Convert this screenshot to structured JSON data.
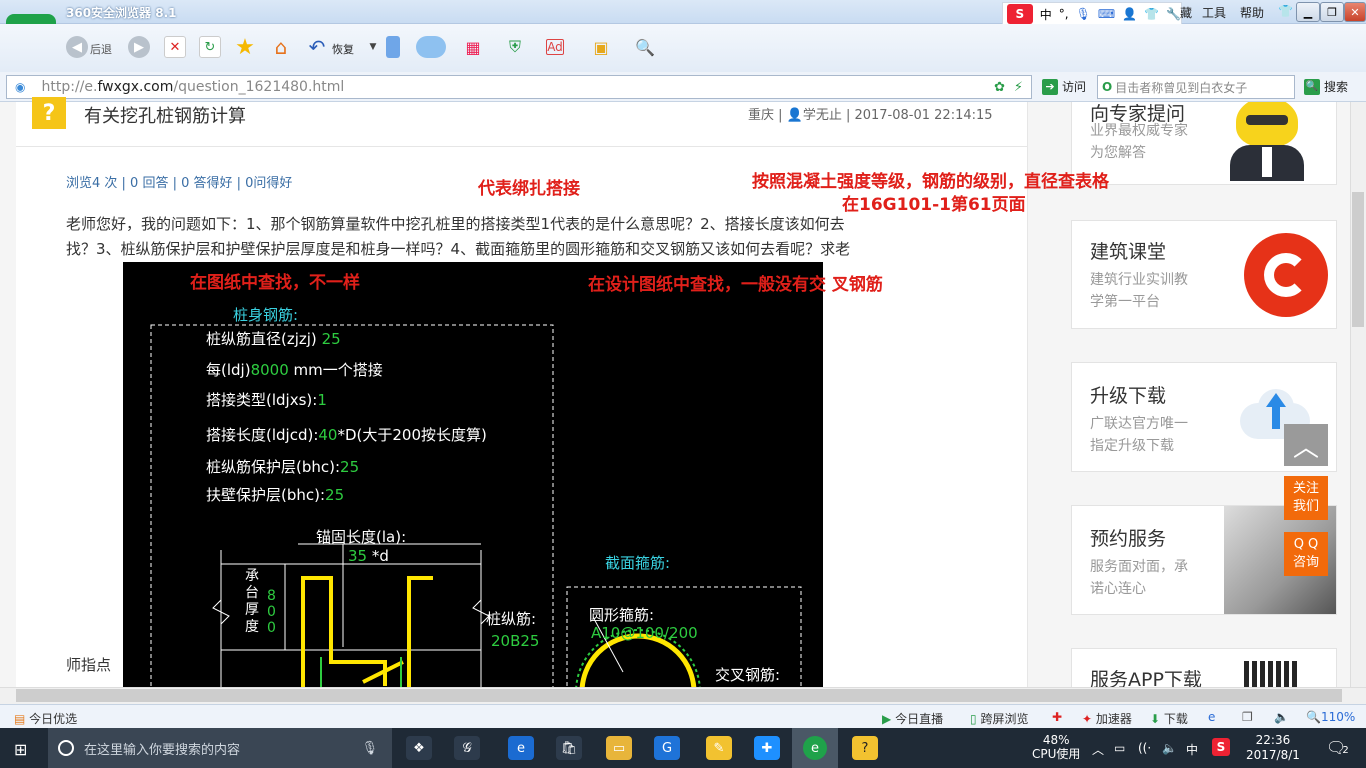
{
  "browser": {
    "title": "360安全浏览器 8.1",
    "logo_letter": "e",
    "menu": [
      "工具",
      "帮助"
    ],
    "menu_partial": "藏",
    "ime": {
      "s": "S",
      "lang": "中",
      "punct": "°,"
    },
    "toolbar": {
      "back": "后退",
      "restore": "恢复"
    },
    "url_prefix": "http://e.",
    "url_domain": "fwxgx.com",
    "url_path": "/question_1621480.html",
    "visit": "访问",
    "search_placeholder": "目击者称曾见到白衣女子",
    "search_btn": "搜索"
  },
  "question": {
    "icon": "?",
    "title": "有关挖孔桩钢筋计算",
    "meta": "重庆 | 👤学无止 | 2017-08-01 22:14:15",
    "stats": "浏览4 次 | 0 回答 | 0 答得好 | 0问得好",
    "body_line1": "老师您好，我的问题如下：1、那个钢筋算量软件中挖孔桩里的搭接类型1代表的是什么意思呢？2、搭接长度该如何去",
    "body_line2": "找？3、桩纵筋保护层和护壁保护层厚度是和桩身一样吗？4、截面箍筋里的圆形箍筋和交叉钢筋又该如何去看呢？求老",
    "fragment": "师指点"
  },
  "annotations": {
    "a1": "代表绑扎搭接",
    "a2": "按照混凝土强度等级，钢筋的级别，直径查表格",
    "a3": "在16G101-1第61页面",
    "a4": "在图纸中查找，不一样",
    "a5": "在设计图纸中查找，一般没有交 叉钢筋"
  },
  "cad": {
    "section1": "桩身钢筋:",
    "l1_label": "桩纵筋直径(zjzj)",
    "l1_val": "25",
    "l2_label": "每(ldj)",
    "l2_val": "8000",
    "l2_tail": "mm一个搭接",
    "l3_label": "搭接类型(ldjxs):",
    "l3_val": "1",
    "l4_label": "搭接长度(ldjcd):",
    "l4_val": "40",
    "l4_tail": "*D(大于200按长度算)",
    "l5_label": "桩纵筋保护层(bhc):",
    "l5_val": "25",
    "l6_label": "扶壁保护层(bhc):",
    "l6_val": "25",
    "anchor_label": "锚固长度(la):",
    "anchor_val": "35",
    "anchor_tail": "*d",
    "cap_label": "承台厚度",
    "cap_val": "800",
    "pile_label": "桩纵筋:",
    "pile_val": "20B25",
    "section2": "截面箍筋:",
    "hoop_label": "圆形箍筋:",
    "hoop_val": "A10@100/200",
    "cross_label": "交叉钢筋:"
  },
  "sidebar": {
    "card0_title": "向专家提问",
    "card0_sub1": "业界最权威专家",
    "card0_sub2": "为您解答",
    "card1_title": "建筑课堂",
    "card1_sub1": "建筑行业实训教",
    "card1_sub2": "学第一平台",
    "card2_title": "升级下载",
    "card2_sub1": "广联达官方唯一",
    "card2_sub2": "指定升级下载",
    "card3_title": "预约服务",
    "card3_sub1": "服务面对面，承",
    "card3_sub2": "诺心连心",
    "card4_title": "服务APP下载",
    "backtop": "︿",
    "follow1": "关注",
    "follow2": "我们",
    "qq1": "Q Q",
    "qq2": "咨询"
  },
  "statusbar": {
    "left": "今日优选",
    "live": "今日直播",
    "cross": "跨屏浏览",
    "accel": "加速器",
    "download": "下载",
    "zoom": "110%"
  },
  "taskbar": {
    "search": "在这里输入你要搜索的内容",
    "cpu_pct": "48%",
    "cpu_label": "CPU使用",
    "ime": "中",
    "time": "22:36",
    "date": "2017/8/1",
    "notif": "2"
  },
  "colors": {
    "accent_red": "#e0201a",
    "cad_green": "#2ecc40",
    "cad_cyan": "#3ad1e0",
    "cad_yellow": "#ffe600"
  }
}
